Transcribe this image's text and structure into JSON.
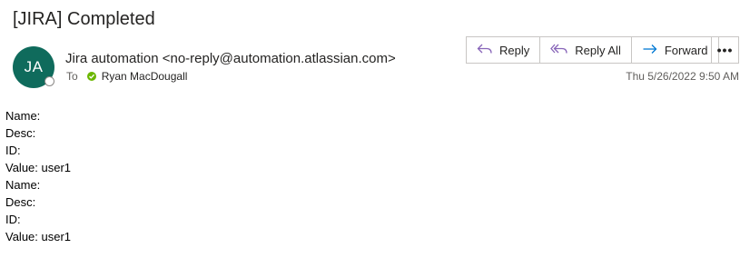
{
  "email": {
    "subject": "[JIRA] Completed",
    "avatar_initials": "JA",
    "avatar_color": "#0f6b5c",
    "sender": "Jira automation <no-reply@automation.atlassian.com>",
    "to_label": "To",
    "recipient": "Ryan MacDougall",
    "timestamp": "Thu 5/26/2022 9:50 AM"
  },
  "actions": {
    "reply": {
      "label": "Reply",
      "icon": "reply-icon"
    },
    "reply_all": {
      "label": "Reply All",
      "icon": "reply-all-icon"
    },
    "forward": {
      "label": "Forward",
      "icon": "forward-icon"
    },
    "more": {
      "label": "•••",
      "icon": "more-icon"
    }
  },
  "body": {
    "lines": [
      "Name:",
      "Desc:",
      "ID:",
      "Value: user1",
      "Name:",
      "Desc:",
      "ID:",
      "Value: user1"
    ]
  }
}
